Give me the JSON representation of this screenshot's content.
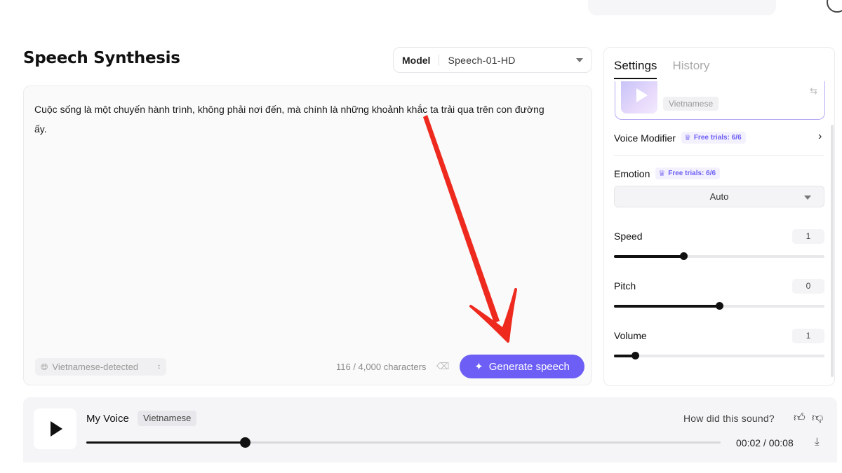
{
  "page_title": "Speech Synthesis",
  "model": {
    "label": "Model",
    "value": "Speech-01-HD"
  },
  "editor": {
    "text": "Cuộc sống là một chuyến hành trình, không phải nơi đến, mà chính là những khoảnh khắc ta trải qua trên con đường ấy.",
    "language": "Vietnamese-detected",
    "char_count": "116 / 4,000 characters",
    "generate_label": "Generate speech"
  },
  "settings": {
    "tabs": [
      {
        "label": "Settings",
        "active": true
      },
      {
        "label": "History",
        "active": false
      }
    ],
    "voice_tag": "Vietnamese",
    "voice_modifier": {
      "label": "Voice Modifier",
      "trial": "Free trials: 6/6"
    },
    "emotion": {
      "label": "Emotion",
      "trial": "Free trials: 6/6",
      "value": "Auto"
    },
    "speed": {
      "label": "Speed",
      "value": "1",
      "level": 0.33
    },
    "pitch": {
      "label": "Pitch",
      "value": "0",
      "level": 0.5
    },
    "volume": {
      "label": "Volume",
      "value": "1",
      "level": 0.1
    }
  },
  "player": {
    "voice_name": "My Voice",
    "voice_tag": "Vietnamese",
    "feedback_prompt": "How did this sound?",
    "time": "00:02 / 00:08",
    "progress": 0.25
  },
  "icons": {
    "globe": "globe-icon",
    "updown": "updown-icon",
    "eraser": "eraser-icon",
    "sparkle": "sparkle-icon",
    "crown": "crown-icon",
    "play": "play-icon",
    "thumbs_up": "thumbs-up-icon",
    "thumbs_down": "thumbs-down-icon",
    "download": "download-icon"
  },
  "colors": {
    "accent": "#6d5ff5",
    "annotation_arrow": "#ee2a1f"
  }
}
